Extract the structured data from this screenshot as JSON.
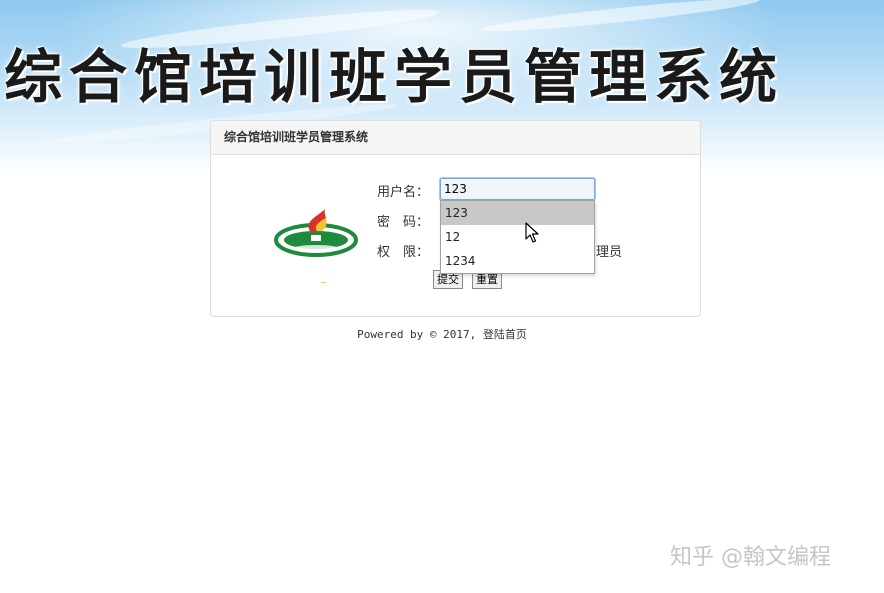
{
  "banner": {
    "title": "综合馆培训班学员管理系统"
  },
  "panel": {
    "heading": "综合馆培训班学员管理系统"
  },
  "form": {
    "username_label": "用户名：",
    "username_value": "123",
    "password_label": "密　码：",
    "role_label": "权　限：",
    "role_option_tail": "理员",
    "submit_label": "提交",
    "reset_label": "重置"
  },
  "autocomplete": {
    "items": [
      {
        "label": "123",
        "selected": true
      },
      {
        "label": "12",
        "selected": false
      },
      {
        "label": "1234",
        "selected": false
      }
    ]
  },
  "footer": {
    "text": "Powered by © 2017, 登陆首页"
  },
  "watermark": {
    "text": "知乎 @翰文编程"
  },
  "colors": {
    "banner_top": "#8ec9ef",
    "input_border": "#7aa8d6",
    "logo_red": "#d8322a",
    "logo_green": "#1e8a3c",
    "logo_yellow": "#f2c12e"
  },
  "icons": {
    "logo": "school-emblem-icon",
    "cursor": "mouse-pointer-icon"
  }
}
